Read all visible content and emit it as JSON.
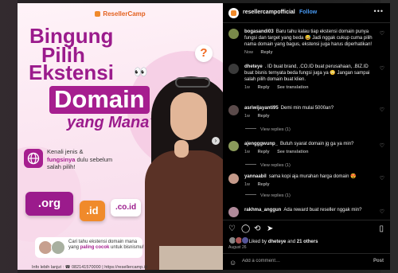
{
  "poster": {
    "brand": "ResellerCamp",
    "headline_1": "Bingung",
    "headline_2": "Pilih",
    "headline_3": "Ekstensi",
    "headline_4": "Domain",
    "headline_5": "yang Mana?",
    "eyes_emoji": "👀",
    "question_mark": "?",
    "subtext_1": "Kenali jenis &",
    "subtext_bold": "fungsinya",
    "subtext_2": "dulu sebelum salah pilih!",
    "chips": [
      ".org",
      ".id",
      ".co.id"
    ],
    "card_text_1": "Cari tahu ekstensi domain mana yang",
    "card_bold": "paling cocok",
    "card_text_2": "untuk bisnismu!",
    "footer_info": "Info lebih lanjut :",
    "footer_phone": "082141570000",
    "footer_url": "https://resellercamp.id"
  },
  "header": {
    "username": "resellercampofficial",
    "follow": "Follow",
    "more": "•••"
  },
  "comments": [
    {
      "user": "bogasandi03",
      "text": "Baru tahu kalau tiap ekstensi domain punya fungsi dan target yang beda 😅 Jadi nggak cukup cuma pilih nama domain yang bagus, ekstensi juga harus diperhatikan!",
      "time": "Now",
      "reply": "Reply",
      "translation": "",
      "avatar_color": "#7a8a4a"
    },
    {
      "user": "dheteye",
      "text": ". ID buat brand, .CO.ID buat perusahaan, .BIZ.ID buat bisnis ternyata beda fungsi juga ya 😳 Jangan sampai salah pilih domain buat klien.",
      "time": "1w",
      "reply": "Reply",
      "translation": "See translation",
      "avatar_color": "#3a3a3a"
    },
    {
      "user": "asriwijayanti95",
      "text": "Demi min mulai 5000an?",
      "time": "1w",
      "reply": "Reply",
      "translation": "",
      "avatar_color": "#5a4a4a",
      "view_replies": "View replies (1)"
    },
    {
      "user": "ajengggwunp_",
      "text": "Butuh syarat domain jg ga ya min?",
      "time": "1w",
      "reply": "Reply",
      "translation": "See translation",
      "avatar_color": "#8a9a5a",
      "view_replies": "View replies (1)"
    },
    {
      "user": "yannaabil",
      "text": "sama kopi aja murahan harga domain 😍",
      "time": "1w",
      "reply": "Reply",
      "translation": "",
      "avatar_color": "#c49a8a",
      "view_replies": "View replies (1)"
    },
    {
      "user": "rakhma_anggun",
      "text": "Ada reward buat reseller nggak min?",
      "time": "",
      "reply": "",
      "translation": "",
      "avatar_color": "#b08a9a"
    }
  ],
  "likes": {
    "prefix": "Liked by",
    "user": "dheteye",
    "middle": "and",
    "others": "21 others"
  },
  "date": "August 26",
  "add_comment": {
    "emoji": "☺",
    "placeholder": "Add a comment…",
    "post": "Post"
  },
  "colors": {
    "accent_purple": "#9b1b8c",
    "accent_orange": "#f08a2b",
    "follow_blue": "#4a9df8"
  }
}
